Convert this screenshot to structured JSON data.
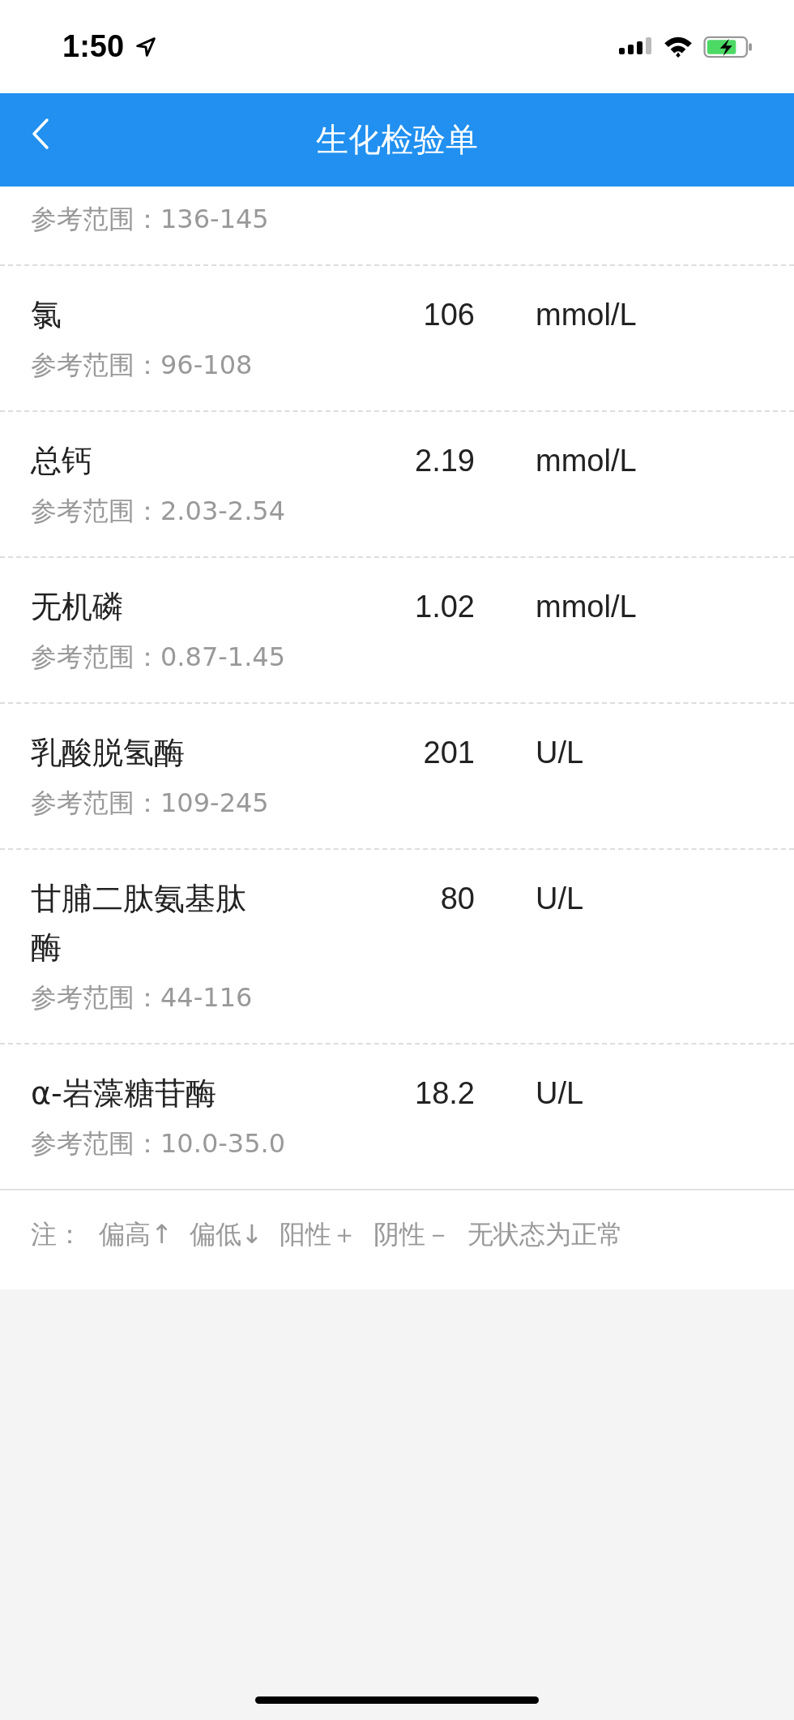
{
  "status_bar": {
    "time": "1:50"
  },
  "header": {
    "title": "生化检验单"
  },
  "rows": [
    {
      "range": "参考范围：136-145"
    },
    {
      "name": "氯",
      "value": "106",
      "unit": "mmol/L",
      "range": "参考范围：96-108"
    },
    {
      "name": "总钙",
      "value": "2.19",
      "unit": "mmol/L",
      "range": "参考范围：2.03-2.54"
    },
    {
      "name": "无机磷",
      "value": "1.02",
      "unit": "mmol/L",
      "range": "参考范围：0.87-1.45"
    },
    {
      "name": "乳酸脱氢酶",
      "value": "201",
      "unit": "U/L",
      "range": "参考范围：109-245"
    },
    {
      "name": "甘脯二肽氨基肽酶",
      "value": "80",
      "unit": "U/L",
      "range": "参考范围：44-116"
    },
    {
      "name": "α-岩藻糖苷酶",
      "value": "18.2",
      "unit": "U/L",
      "range": "参考范围：10.0-35.0"
    }
  ],
  "note": "注：  偏高↑  偏低↓  阳性＋  阴性－  无状态为正常"
}
